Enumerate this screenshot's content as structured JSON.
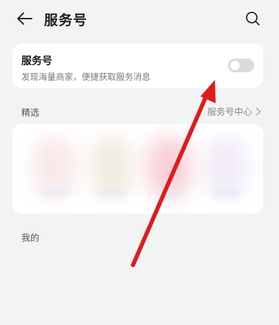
{
  "header": {
    "title": "服务号",
    "back_icon": "arrow-left-icon",
    "search_icon": "search-icon"
  },
  "toggle_card": {
    "title": "服务号",
    "description": "发现海量商家，便捷获取服务消息",
    "switch_on": false
  },
  "featured": {
    "label": "精选",
    "center_link": "服务号中心"
  },
  "mine": {
    "label": "我的"
  },
  "colors": {
    "background": "#f1f3f5",
    "card": "#ffffff",
    "switch_off": "#d9dbde",
    "annotation": "#e01b1b"
  }
}
